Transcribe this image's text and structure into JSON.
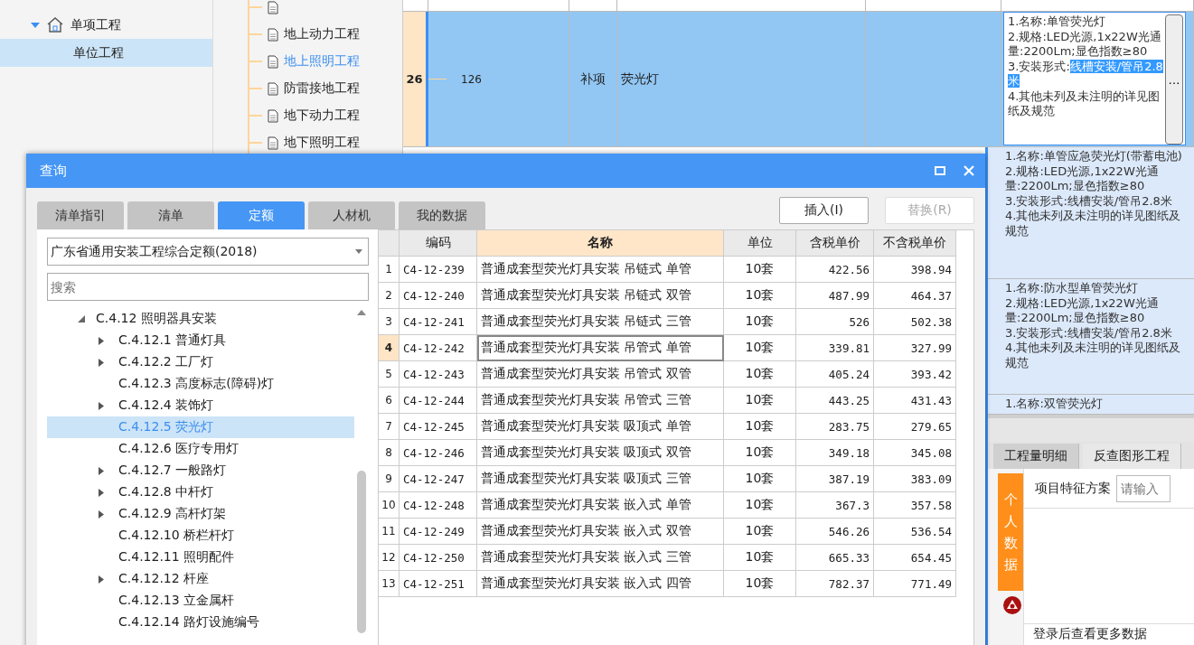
{
  "project_tree": [
    {
      "label": "单项工程",
      "expanded": true,
      "selected": false,
      "children": [
        {
          "label": "单位工程",
          "selected": true
        }
      ]
    }
  ],
  "file_list": [
    {
      "selected": false
    },
    {
      "label": "地上动力工程",
      "selected": false
    },
    {
      "label": "地上照明工程",
      "selected": true
    },
    {
      "label": "防雷接地工程",
      "selected": false
    },
    {
      "label": "地下动力工程",
      "selected": false
    },
    {
      "label": "地下照明工程",
      "selected": false
    }
  ],
  "grid": {
    "current_row": {
      "row_number": "26",
      "code": "126",
      "type": "补项",
      "name": "荧光灯",
      "selected": true,
      "feature_editor": {
        "items": [
          {
            "text": "1.名称:单管荧光灯"
          },
          {
            "text": "2.规格:LED光源,1x22W光通量:2200Lm;显色指数≥80"
          },
          {
            "text": "3.安装形式:",
            "selection": "线槽安装/管吊2.8米"
          },
          {
            "text": "4.其他未列及未注明的详见图纸及规范"
          }
        ],
        "button": "…"
      }
    },
    "feature_rows": [
      {
        "items": [
          "1.名称:单管应急荧光灯(带蓄电池)",
          "2.规格:LED光源,1x22W光通量:2200Lm;显色指数≥80",
          "3.安装形式:线槽安装/管吊2.8米",
          "4.其他未列及未注明的详见图纸及规范"
        ]
      },
      {
        "items": [
          "1.名称:防水型单管荧光灯",
          "2.规格:LED光源,1x22W光通量:2200Lm;显色指数≥80",
          "3.安装形式:线槽安装/管吊2.8米",
          "4.其他未列及未注明的详见图纸及规范"
        ]
      },
      {
        "items": [
          "1.名称:双管荧光灯"
        ]
      }
    ]
  },
  "bottom_panel": {
    "tabs": [
      {
        "label": "工程量明细",
        "selected": true
      },
      {
        "label": "反查图形工程",
        "selected": false
      }
    ],
    "side_button": "个人数据",
    "scheme_label": "项目特征方案",
    "scheme_input": {
      "placeholder": "请输入"
    },
    "login_hint": "登录后查看更多数据"
  },
  "dialog": {
    "title": "查询",
    "tabs": [
      {
        "label": "清单指引",
        "selected": false
      },
      {
        "label": "清单",
        "selected": false
      },
      {
        "label": "定额",
        "selected": true
      },
      {
        "label": "人材机",
        "selected": false
      },
      {
        "label": "我的数据",
        "selected": false
      }
    ],
    "buttons": [
      {
        "label": "插入(I)",
        "disabled": false
      },
      {
        "label": "替换(R)",
        "disabled": true
      }
    ],
    "library": "广东省通用安装工程综合定额(2018)",
    "search": {
      "placeholder": "搜索"
    },
    "tree": [
      {
        "label": "C.4.12 照明器具安装",
        "expanded": true,
        "selected": false,
        "children": [
          {
            "label": "C.4.12.1 普通灯具",
            "expanded": false,
            "has_children": true,
            "selected": false
          },
          {
            "label": "C.4.12.2 工厂灯",
            "expanded": false,
            "has_children": true,
            "selected": false
          },
          {
            "label": "C.4.12.3 高度标志(障碍)灯",
            "has_children": false,
            "selected": false
          },
          {
            "label": "C.4.12.4 装饰灯",
            "expanded": false,
            "has_children": true,
            "selected": false
          },
          {
            "label": "C.4.12.5 荧光灯",
            "has_children": false,
            "selected": true
          },
          {
            "label": "C.4.12.6 医疗专用灯",
            "has_children": false,
            "selected": false
          },
          {
            "label": "C.4.12.7 一般路灯",
            "expanded": false,
            "has_children": true,
            "selected": false
          },
          {
            "label": "C.4.12.8 中杆灯",
            "expanded": false,
            "has_children": true,
            "selected": false
          },
          {
            "label": "C.4.12.9 高杆灯架",
            "expanded": false,
            "has_children": true,
            "selected": false
          },
          {
            "label": "C.4.12.10 桥栏杆灯",
            "has_children": false,
            "selected": false
          },
          {
            "label": "C.4.12.11 照明配件",
            "has_children": false,
            "selected": false
          },
          {
            "label": "C.4.12.12 杆座",
            "expanded": false,
            "has_children": true,
            "selected": false
          },
          {
            "label": "C.4.12.13 立金属杆",
            "has_children": false,
            "selected": false
          },
          {
            "label": "C.4.12.14 路灯设施编号",
            "has_children": false,
            "selected": false
          }
        ]
      }
    ],
    "table": {
      "columns": [
        {
          "label": "编码",
          "selected": false
        },
        {
          "label": "名称",
          "selected": true
        },
        {
          "label": "单位",
          "selected": false
        },
        {
          "label": "含税单价",
          "selected": false
        },
        {
          "label": "不含税单价",
          "selected": false
        }
      ],
      "rows": [
        {
          "no": "1",
          "cells": [
            "C4-12-239",
            "普通成套型荧光灯具安装 吊链式 单管",
            "10套",
            "422.56",
            "398.94"
          ],
          "selected": false
        },
        {
          "no": "2",
          "cells": [
            "C4-12-240",
            "普通成套型荧光灯具安装 吊链式 双管",
            "10套",
            "487.99",
            "464.37"
          ],
          "selected": false
        },
        {
          "no": "3",
          "cells": [
            "C4-12-241",
            "普通成套型荧光灯具安装 吊链式 三管",
            "10套",
            "526",
            "502.38"
          ],
          "selected": false
        },
        {
          "no": "4",
          "cells": [
            "C4-12-242",
            "普通成套型荧光灯具安装 吊管式 单管",
            "10套",
            "339.81",
            "327.99"
          ],
          "selected": true
        },
        {
          "no": "5",
          "cells": [
            "C4-12-243",
            "普通成套型荧光灯具安装 吊管式 双管",
            "10套",
            "405.24",
            "393.42"
          ],
          "selected": false
        },
        {
          "no": "6",
          "cells": [
            "C4-12-244",
            "普通成套型荧光灯具安装 吊管式 三管",
            "10套",
            "443.25",
            "431.43"
          ],
          "selected": false
        },
        {
          "no": "7",
          "cells": [
            "C4-12-245",
            "普通成套型荧光灯具安装 吸顶式 单管",
            "10套",
            "283.75",
            "279.65"
          ],
          "selected": false
        },
        {
          "no": "8",
          "cells": [
            "C4-12-246",
            "普通成套型荧光灯具安装 吸顶式 双管",
            "10套",
            "349.18",
            "345.08"
          ],
          "selected": false
        },
        {
          "no": "9",
          "cells": [
            "C4-12-247",
            "普通成套型荧光灯具安装 吸顶式 三管",
            "10套",
            "387.19",
            "383.09"
          ],
          "selected": false
        },
        {
          "no": "10",
          "cells": [
            "C4-12-248",
            "普通成套型荧光灯具安装 嵌入式 单管",
            "10套",
            "367.3",
            "357.58"
          ],
          "selected": false
        },
        {
          "no": "11",
          "cells": [
            "C4-12-249",
            "普通成套型荧光灯具安装 嵌入式 双管",
            "10套",
            "546.26",
            "536.54"
          ],
          "selected": false
        },
        {
          "no": "12",
          "cells": [
            "C4-12-250",
            "普通成套型荧光灯具安装 嵌入式 三管",
            "10套",
            "665.33",
            "654.45"
          ],
          "selected": false
        },
        {
          "no": "13",
          "cells": [
            "C4-12-251",
            "普通成套型荧光灯具安装 嵌入式 四管",
            "10套",
            "782.37",
            "771.49"
          ],
          "selected": false
        }
      ]
    }
  }
}
